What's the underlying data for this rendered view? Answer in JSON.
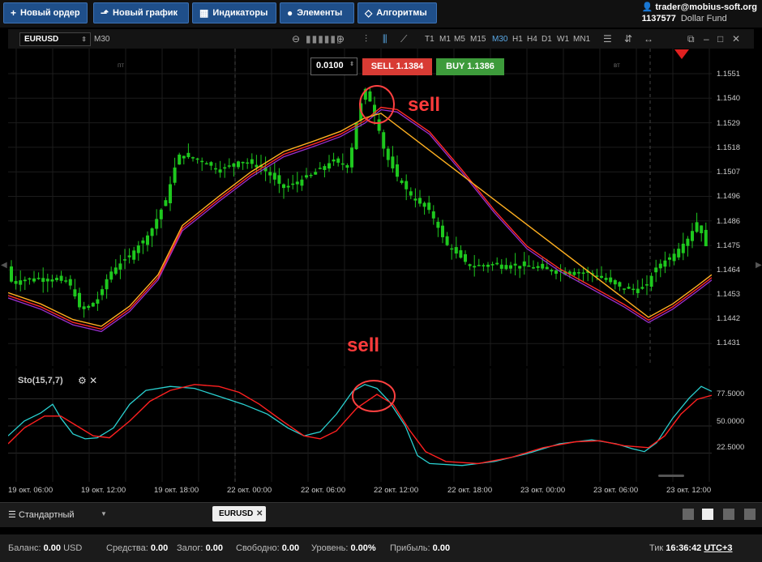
{
  "topbar": {
    "buttons": [
      {
        "label": "Новый ордер",
        "icon": "plus-icon"
      },
      {
        "label": "Новый график",
        "icon": "chart-icon"
      },
      {
        "label": "Индикаторы",
        "icon": "indicators-icon"
      },
      {
        "label": "Элементы",
        "icon": "elements-icon"
      },
      {
        "label": "Алгоритмы",
        "icon": "algorithms-icon"
      }
    ],
    "user": "trader@mobius-soft.org",
    "account": "1137577",
    "fund": "Dollar Fund"
  },
  "toolbar": {
    "symbol": "EURUSD",
    "timeframe": "M30",
    "timeframes": [
      "T1",
      "M1",
      "M5",
      "M15",
      "M30",
      "H1",
      "H4",
      "D1",
      "W1",
      "MN1"
    ],
    "active_timeframe": "M30"
  },
  "order": {
    "volume": "0.0100",
    "sell_label": "SELL 1.1384",
    "buy_label": "BUY 1.1386"
  },
  "chart": {
    "day_labels": [
      "пт",
      "вт"
    ],
    "annotation_top": "sell",
    "annotation_bottom": "sell",
    "y_labels": [
      "1.1551",
      "1.1540",
      "1.1529",
      "1.1518",
      "1.1507",
      "1.1496",
      "1.1486",
      "1.1475",
      "1.1464",
      "1.1453",
      "1.1442",
      "1.1431"
    ],
    "sto_label": "Sto(15,7,7)",
    "sto_levels": [
      "77.5000",
      "50.0000",
      "22.5000"
    ],
    "x_labels": [
      "19 окт. 06:00",
      "19 окт. 12:00",
      "19 окт. 18:00",
      "22 окт. 00:00",
      "22 окт. 06:00",
      "22 окт. 12:00",
      "22 окт. 18:00",
      "23 окт. 00:00",
      "23 окт. 06:00",
      "23 окт. 12:00"
    ]
  },
  "chart_data": {
    "type": "candlestick",
    "symbol": "EURUSD",
    "timeframe": "M30",
    "ylim": [
      1.1425,
      1.156
    ],
    "up_color": "#1ec81e",
    "down_color": "#1ec81e",
    "ma_colors": [
      "#ff2a2a",
      "#ffb020",
      "#9a2fd0"
    ],
    "stochastic": {
      "params": "Sto(15,7,7)",
      "ylim": [
        0,
        100
      ],
      "levels": [
        22.5,
        50,
        77.5
      ],
      "main_color": "#2ad0d0",
      "signal_color": "#ff2020"
    }
  },
  "bottom": {
    "workspace": "Стандартный",
    "tab": "EURUSD"
  },
  "status": {
    "balance_label": "Баланс:",
    "balance": "0.00",
    "balance_ccy": "USD",
    "funds_label": "Средства:",
    "funds": "0.00",
    "margin_label": "Залог:",
    "margin": "0.00",
    "free_label": "Свободно:",
    "free": "0.00",
    "level_label": "Уровень:",
    "level": "0.00%",
    "profit_label": "Прибыль:",
    "profit": "0.00",
    "tick_label": "Тик",
    "time": "16:36:42",
    "tz": "UTC+3"
  }
}
